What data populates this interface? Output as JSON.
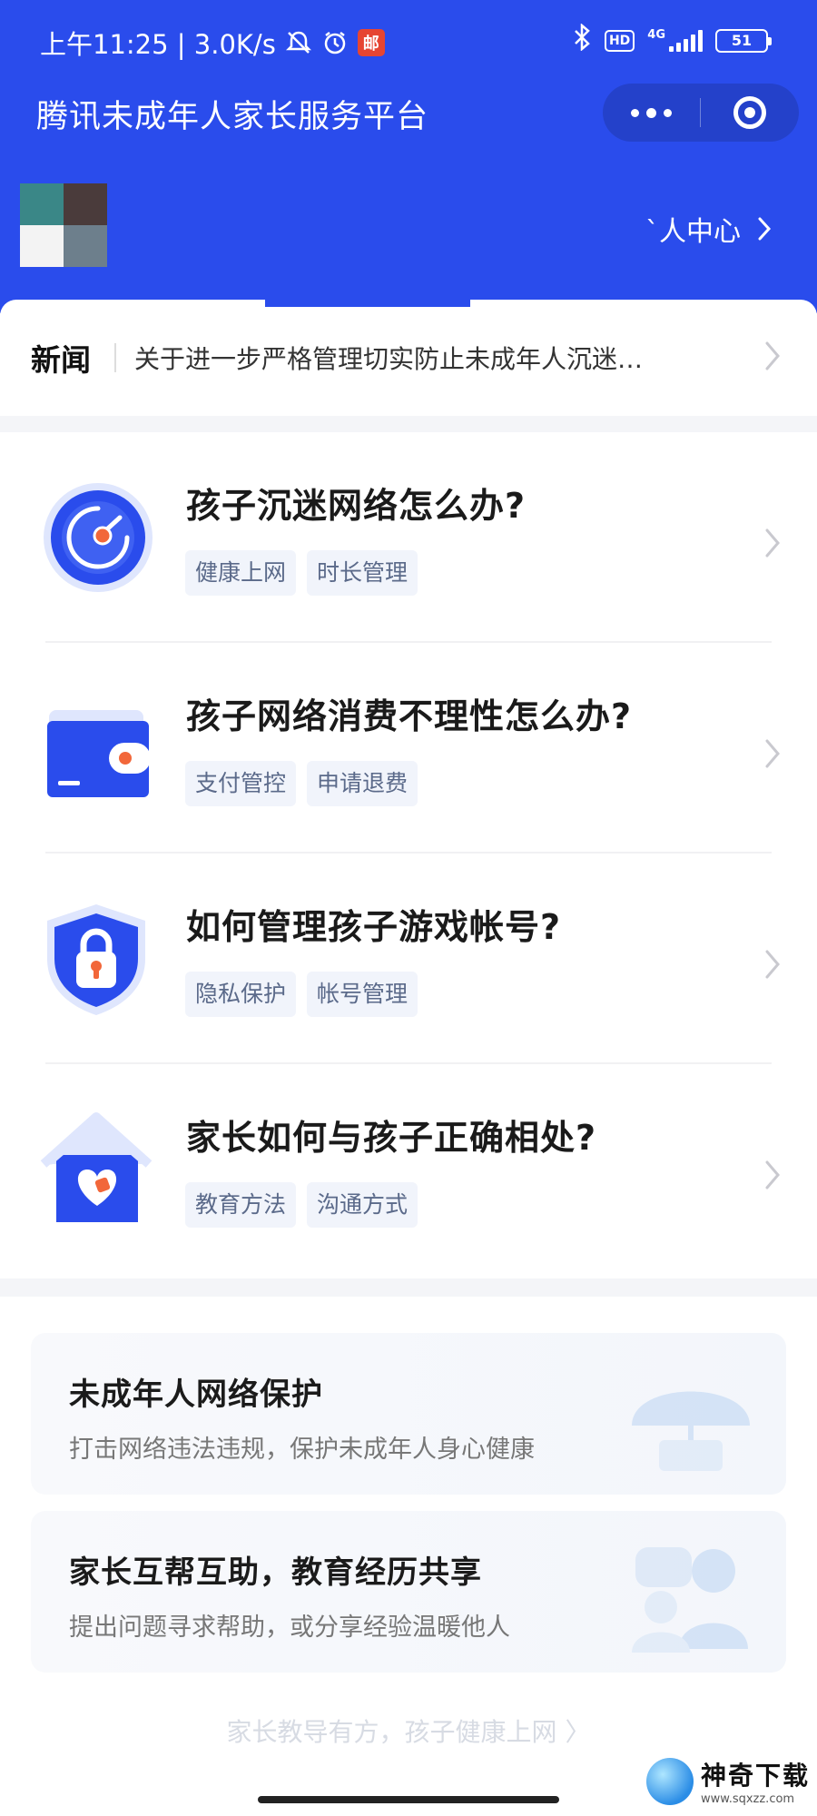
{
  "status_bar": {
    "time_speed": "上午11:25 | 3.0K/s",
    "mail_badge": "邮",
    "hd": "HD",
    "network": "4G",
    "battery": "51"
  },
  "header": {
    "title": "腾讯未成年人家长服务平台",
    "user_center": "`人中心"
  },
  "news": {
    "label": "新闻",
    "headline": "关于进一步严格管理切实防止未成年人沉迷…"
  },
  "faq": [
    {
      "title": "孩子沉迷网络怎么办?",
      "tags": [
        "健康上网",
        "时长管理"
      ],
      "icon": "radar-clock-icon"
    },
    {
      "title": "孩子网络消费不理性怎么办?",
      "tags": [
        "支付管控",
        "申请退费"
      ],
      "icon": "wallet-icon"
    },
    {
      "title": "如何管理孩子游戏帐号?",
      "tags": [
        "隐私保护",
        "帐号管理"
      ],
      "icon": "shield-lock-icon"
    },
    {
      "title": "家长如何与孩子正确相处?",
      "tags": [
        "教育方法",
        "沟通方式"
      ],
      "icon": "house-heart-icon"
    }
  ],
  "features": [
    {
      "title": "未成年人网络保护",
      "subtitle": "打击网络违法违规，保护未成年人身心健康"
    },
    {
      "title": "家长互帮互助，教育经历共享",
      "subtitle": "提出问题寻求帮助，或分享经验温暖他人"
    }
  ],
  "footer": {
    "slogan": "家长教导有方，孩子健康上网 〉"
  },
  "watermark": {
    "name": "神奇下载",
    "url": "www.sqxzz.com"
  },
  "colors": {
    "brand_blue": "#2a4cec",
    "accent_orange": "#f2673a"
  }
}
